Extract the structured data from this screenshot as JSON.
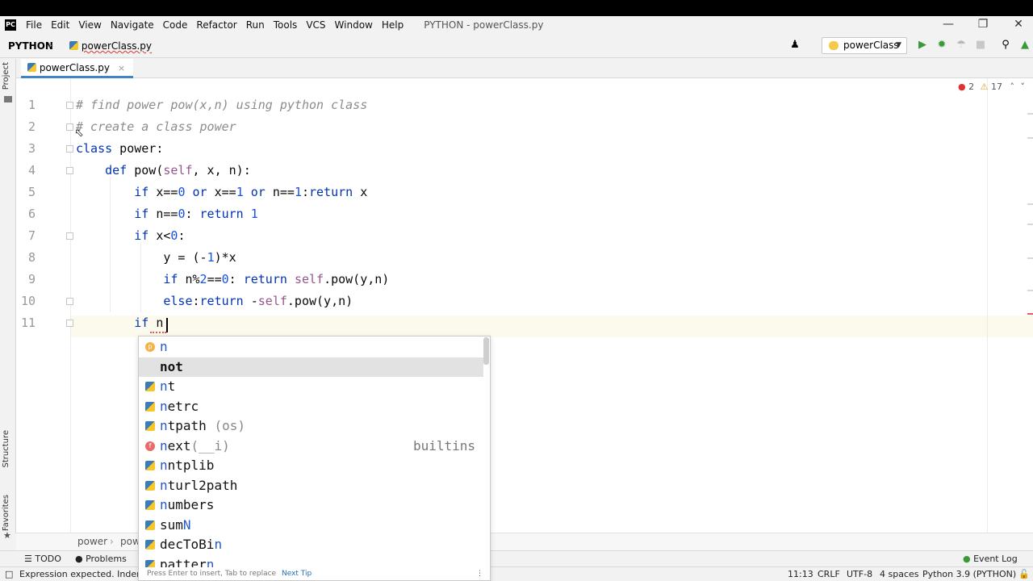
{
  "menu": {
    "logo": "PC",
    "items": [
      "File",
      "Edit",
      "View",
      "Navigate",
      "Code",
      "Refactor",
      "Run",
      "Tools",
      "VCS",
      "Window",
      "Help"
    ],
    "window_title": "PYTHON - powerClass.py"
  },
  "navbar": {
    "project": "PYTHON",
    "file": "powerClass.py",
    "run_config": "powerClass"
  },
  "left_strip": {
    "project_label": "Project",
    "structure_label": "Structure",
    "favorites_label": "Favorites"
  },
  "tabs": [
    {
      "label": "powerClass.py",
      "close": "×"
    }
  ],
  "inspections": {
    "errors": "2",
    "warnings": "17"
  },
  "editor": {
    "line_numbers": [
      "1",
      "2",
      "3",
      "4",
      "5",
      "6",
      "7",
      "8",
      "9",
      "10",
      "11"
    ]
  },
  "breadcrumbs": [
    "power",
    "pow"
  ],
  "completion": {
    "items": [
      {
        "icon": "p",
        "kind": "parameter",
        "prefix": "n",
        "rest": "",
        "hint": "",
        "type": ""
      },
      {
        "icon": "",
        "kind": "keyword",
        "prefix": "n",
        "rest": "ot",
        "hint": "",
        "type": ""
      },
      {
        "icon": "",
        "kind": "module",
        "prefix": "n",
        "rest": "t",
        "hint": "",
        "type": ""
      },
      {
        "icon": "",
        "kind": "module",
        "prefix": "n",
        "rest": "etrc",
        "hint": "",
        "type": ""
      },
      {
        "icon": "",
        "kind": "module",
        "prefix": "n",
        "rest": "tpath",
        "hint": " (os)",
        "type": ""
      },
      {
        "icon": "f",
        "kind": "function",
        "prefix": "n",
        "rest": "ext",
        "hint": "(__i)",
        "type": "builtins"
      },
      {
        "icon": "",
        "kind": "module",
        "prefix": "n",
        "rest": "ntplib",
        "hint": "",
        "type": ""
      },
      {
        "icon": "",
        "kind": "module",
        "prefix": "n",
        "rest": "turl2path",
        "hint": "",
        "type": ""
      },
      {
        "icon": "",
        "kind": "module",
        "prefix": "n",
        "rest": "umbers",
        "hint": "",
        "type": ""
      },
      {
        "icon": "",
        "kind": "module",
        "prefix": "sum",
        "rest": "N",
        "hint": "",
        "type": ""
      },
      {
        "icon": "",
        "kind": "module",
        "prefix": "decToBi",
        "rest": "n",
        "hint": "",
        "type": ""
      },
      {
        "icon": "",
        "kind": "module",
        "prefix": "patter",
        "rest": "n",
        "hint": "",
        "type": ""
      }
    ],
    "footer_hint": "Press Enter to insert, Tab to replace",
    "footer_tip": "Next Tip"
  },
  "tool_windows": {
    "todo": "TODO",
    "problems": "Problems",
    "event_log": "Event Log"
  },
  "status": {
    "message": "Expression expected. Indent ex",
    "position": "11:13",
    "line_sep": "CRLF",
    "encoding": "UTF-8",
    "indent": "4 spaces",
    "interpreter": "Python 3.9 (PYTHON)"
  }
}
